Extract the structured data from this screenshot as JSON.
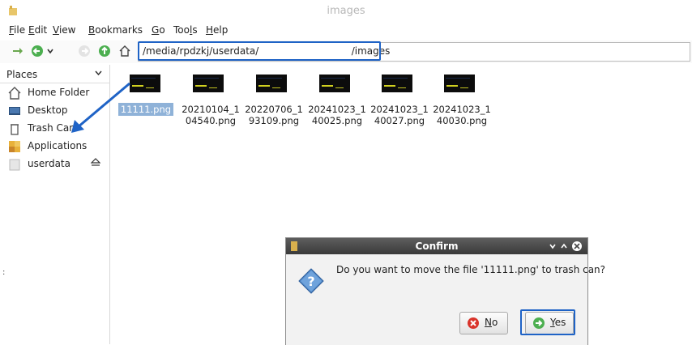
{
  "window": {
    "title": "images"
  },
  "menu": [
    {
      "label": "File",
      "mnemonic": "F",
      "rest": "ile"
    },
    {
      "label": "Edit",
      "mnemonic": "E",
      "rest": "dit"
    },
    {
      "label": "View",
      "mnemonic": "V",
      "rest": "iew"
    },
    {
      "label": "Bookmarks",
      "mnemonic": "B",
      "rest": "ookmarks"
    },
    {
      "label": "Go",
      "mnemonic": "G",
      "rest": "o"
    },
    {
      "label": "Tools",
      "pre": "Too",
      "mnemonic": "l",
      "rest": "s"
    },
    {
      "label": "Help",
      "mnemonic": "H",
      "rest": "elp"
    }
  ],
  "address": {
    "value": "/media/rpdzkj/userdata/                              /images"
  },
  "sidebar": {
    "header": "Places",
    "items": [
      {
        "label": "Home Folder",
        "icon": "home-icon"
      },
      {
        "label": "Desktop",
        "icon": "desktop-icon"
      },
      {
        "label": "Trash Can",
        "icon": "trash-icon"
      },
      {
        "label": "Applications",
        "icon": "applications-icon"
      },
      {
        "label": "userdata",
        "icon": "drive-icon"
      }
    ]
  },
  "files": [
    {
      "line1": "11111.png",
      "line2": "",
      "selected": true
    },
    {
      "line1": "20210104_1",
      "line2": "04540.png",
      "selected": false
    },
    {
      "line1": "20220706_1",
      "line2": "93109.png",
      "selected": false
    },
    {
      "line1": "20241023_1",
      "line2": "40025.png",
      "selected": false
    },
    {
      "line1": "20241023_1",
      "line2": "40027.png",
      "selected": false
    },
    {
      "line1": "20241023_1",
      "line2": "40030.png",
      "selected": false
    }
  ],
  "dialog": {
    "title": "Confirm",
    "message": "Do you want to move the file '11111.png' to trash can?",
    "no": {
      "mnemonic": "N",
      "rest": "o"
    },
    "yes": {
      "mnemonic": "Y",
      "rest": "es"
    }
  },
  "colors": {
    "highlight_border": "#1f63c6",
    "selection": "#8fb2d8",
    "dialog_title": "#4a4a4a"
  }
}
